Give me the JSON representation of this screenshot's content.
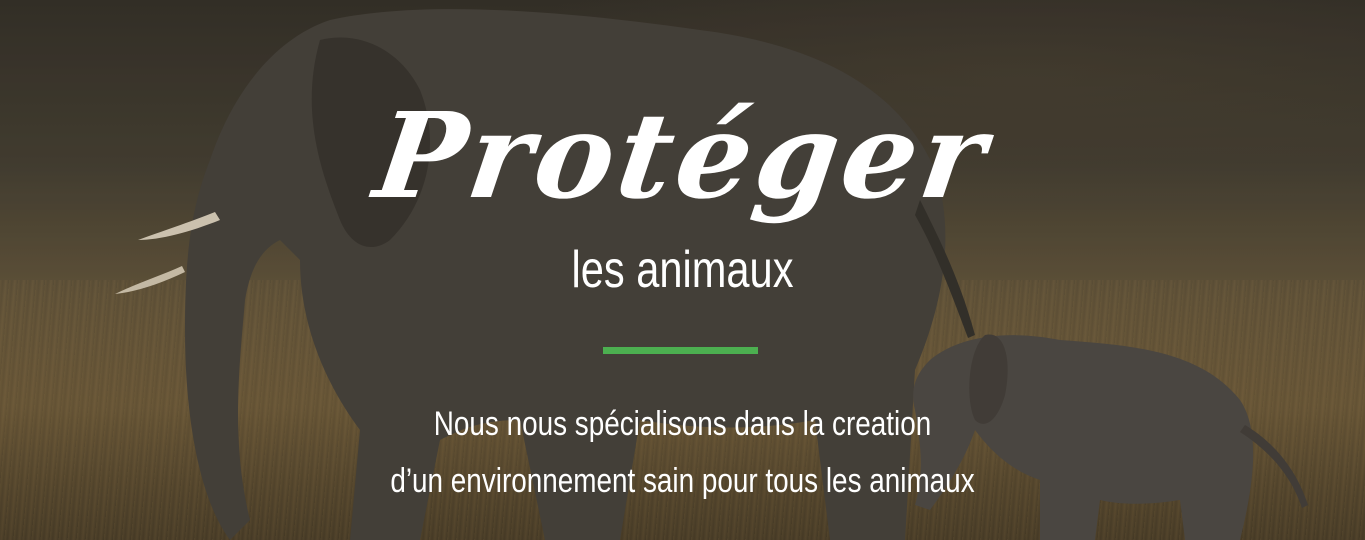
{
  "hero": {
    "title": "Protéger",
    "subtitle": "les animaux",
    "description_line1": "Nous nous spécialisons dans la creation",
    "description_line2": "d’un environnement sain pour tous les animaux",
    "accent_color": "#4caf50"
  }
}
